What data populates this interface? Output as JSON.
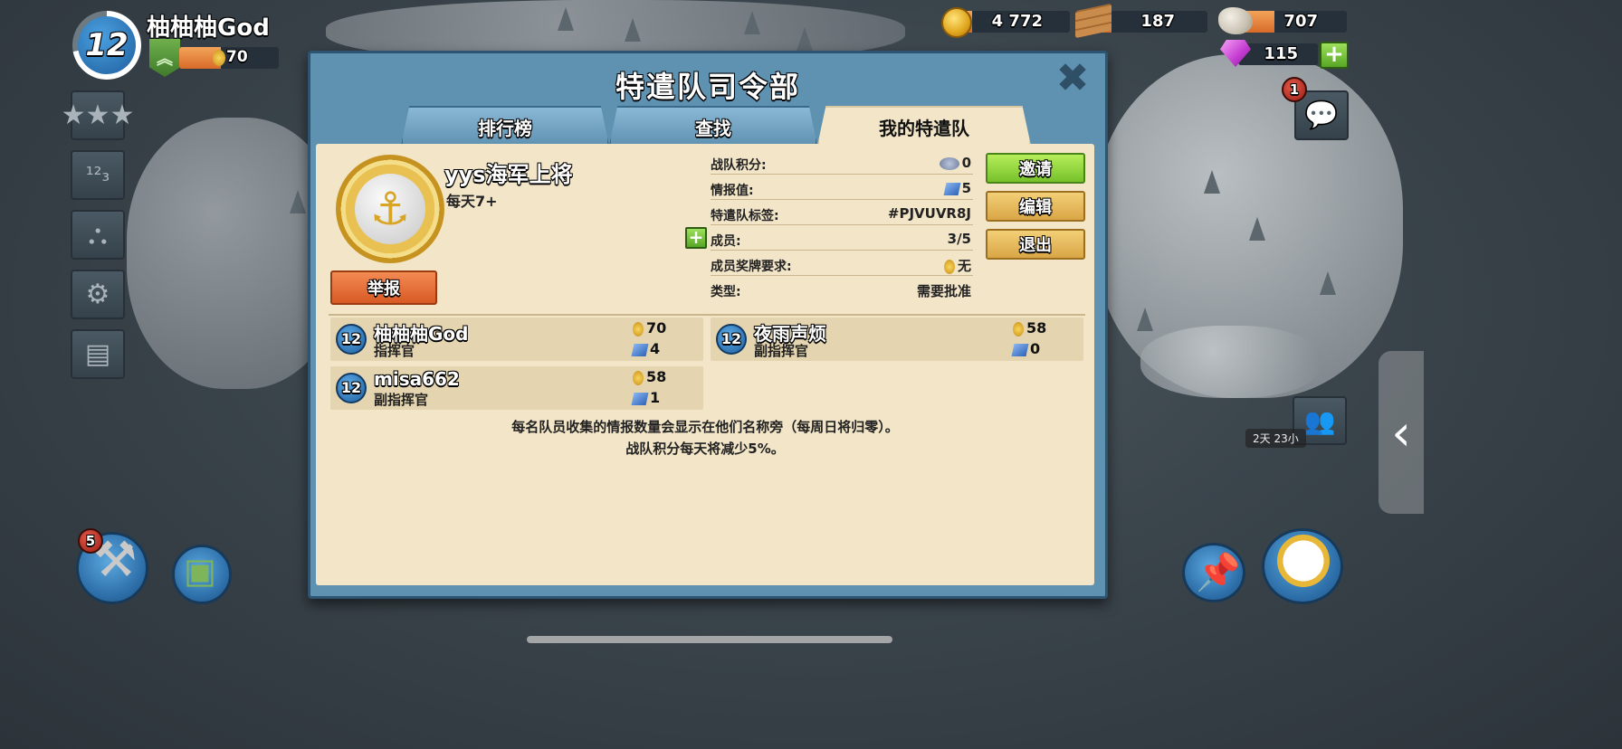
{
  "player": {
    "level": "12",
    "name": "柚柚柚God",
    "medals": "70"
  },
  "resources": {
    "gold": "4 772",
    "wood": "187",
    "stone": "707",
    "diamonds": "115",
    "add_label": "+"
  },
  "sidebar_left": {
    "items": [
      {
        "icon": "stars-icon",
        "glyph": "★★★"
      },
      {
        "icon": "leaderboard-icon",
        "glyph": "¹²₃"
      },
      {
        "icon": "community-icon",
        "glyph": "⛬"
      },
      {
        "icon": "settings-icon",
        "glyph": "⚙"
      },
      {
        "icon": "newspaper-icon",
        "glyph": "▤"
      }
    ]
  },
  "right_side": {
    "chat_badge": "1",
    "chat_glyph": "💬",
    "side_tab_glyph": "‹",
    "timer_text": "2天 23小"
  },
  "bottom_left": {
    "build_badge": "5"
  },
  "dialog": {
    "title": "特遣队司令部",
    "close_glyph": "✖",
    "tabs": [
      {
        "label": "排行榜",
        "active": false
      },
      {
        "label": "查找",
        "active": false
      },
      {
        "label": "我的特遣队",
        "active": true
      }
    ],
    "team": {
      "name": "yys海军上将",
      "description": "每天7+",
      "emblem_glyph": "⚓",
      "report_label": "举报"
    },
    "info": [
      {
        "label": "战队积分:",
        "value": "0",
        "icon": "victory-points-icon"
      },
      {
        "label": "情报值:",
        "value": "5",
        "icon": "intel-icon"
      },
      {
        "label": "特遣队标签:",
        "value": "#PJVUVR8J",
        "icon": ""
      },
      {
        "label": "成员:",
        "value": "3/5",
        "icon": ""
      },
      {
        "label": "成员奖牌要求:",
        "value": "无",
        "icon": "medal-icon"
      },
      {
        "label": "类型:",
        "value": "需要批准",
        "icon": ""
      }
    ],
    "actions": {
      "invite": "邀请",
      "edit": "编辑",
      "leave": "退出"
    },
    "members": [
      {
        "level": "12",
        "name": "柚柚柚God",
        "role": "指挥官",
        "medals": "70",
        "intel": "4"
      },
      {
        "level": "12",
        "name": "夜雨声烦",
        "role": "副指挥官",
        "medals": "58",
        "intel": "0"
      },
      {
        "level": "12",
        "name": "misa662",
        "role": "副指挥官",
        "medals": "58",
        "intel": "1"
      }
    ],
    "notes": [
      "每名队员收集的情报数量会显示在他们名称旁（每周日将归零）。",
      "战队积分每天将减少5%。"
    ]
  }
}
